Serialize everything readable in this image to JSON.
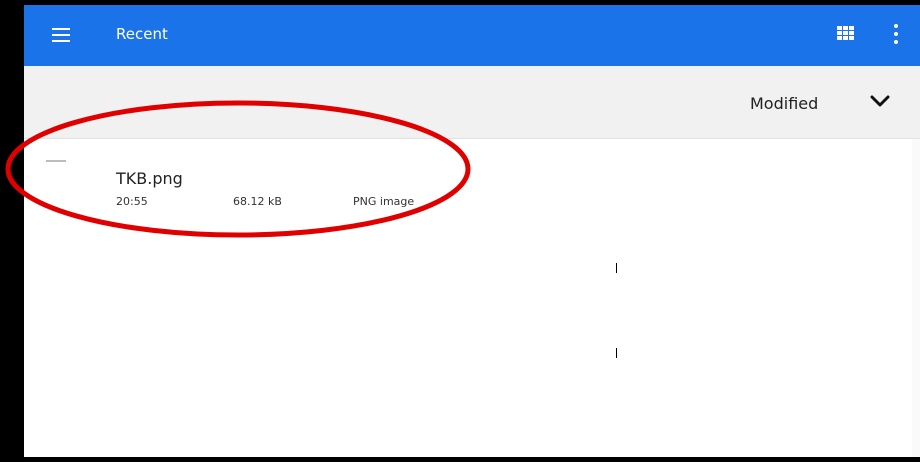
{
  "appbar": {
    "title": "Recent",
    "menu_icon": "hamburger-menu-icon",
    "grid_icon": "grid-view-icon",
    "more_icon": "more-vert-icon",
    "color": "#1a73e8"
  },
  "sort": {
    "label": "Modified",
    "icon": "chevron-down-icon"
  },
  "files": [
    {
      "name": "TKB.png",
      "time": "20:55",
      "size": "68.12 kB",
      "type": "PNG image"
    }
  ],
  "annotation": {
    "shape": "ellipse",
    "color": "#e00000"
  }
}
